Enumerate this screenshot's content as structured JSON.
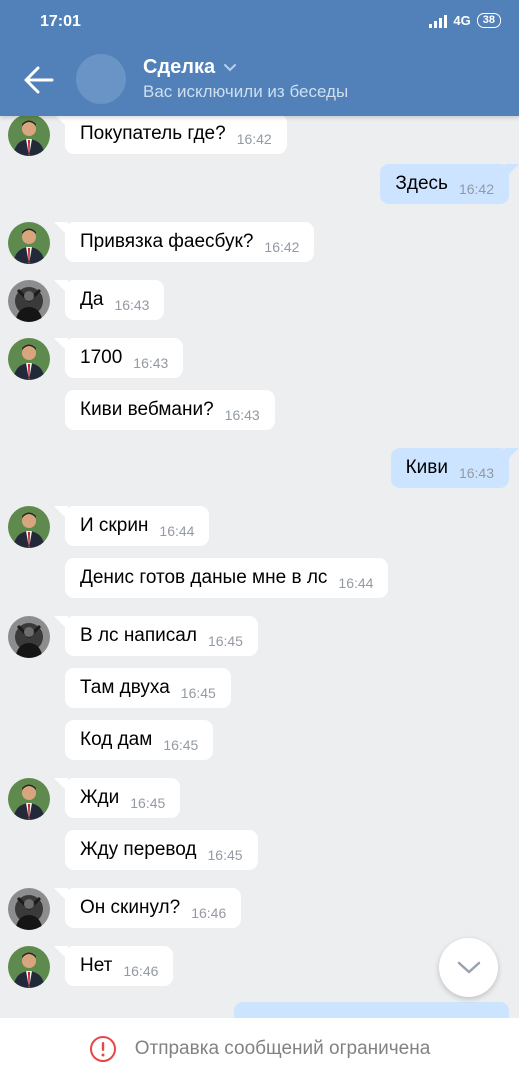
{
  "status_bar": {
    "time": "17:01",
    "network": "4G",
    "battery": "38"
  },
  "header": {
    "title": "Сделка",
    "subtitle": "Вас исключили из беседы"
  },
  "messages": [
    {
      "dir": "in",
      "avatar": "red",
      "text": "Покупатель где?",
      "time": "16:42"
    },
    {
      "dir": "out",
      "text": "Здесь",
      "time": "16:42"
    },
    {
      "dir": "in",
      "avatar": "red",
      "text": "Привязка фаесбук?",
      "time": "16:42"
    },
    {
      "dir": "in",
      "avatar": "dark",
      "text": "Да",
      "time": "16:43"
    },
    {
      "dir": "in",
      "avatar": "red",
      "text": "1700",
      "time": "16:43"
    },
    {
      "dir": "in",
      "text": "Киви вебмани?",
      "time": "16:43"
    },
    {
      "dir": "out",
      "text": "Киви",
      "time": "16:43"
    },
    {
      "dir": "in",
      "avatar": "red",
      "text": "И скрин",
      "time": "16:44"
    },
    {
      "dir": "in",
      "text": "Денис готов даные мне в лс",
      "time": "16:44"
    },
    {
      "dir": "in",
      "avatar": "dark",
      "text": "В лс написал",
      "time": "16:45"
    },
    {
      "dir": "in",
      "text": "Там двуха",
      "time": "16:45"
    },
    {
      "dir": "in",
      "text": "Код дам",
      "time": "16:45"
    },
    {
      "dir": "in",
      "avatar": "red",
      "text": "Жди",
      "time": "16:45"
    },
    {
      "dir": "in",
      "text": "Жду перевод",
      "time": "16:45"
    },
    {
      "dir": "in",
      "avatar": "dark",
      "text": "Он скинул?",
      "time": "16:46"
    },
    {
      "dir": "in",
      "avatar": "red",
      "text": "Нет",
      "time": "16:46"
    }
  ],
  "footer": {
    "restriction_text": "Отправка сообщений ограничена"
  },
  "icons": {
    "back": "back-arrow-icon",
    "title_dropdown": "chevron-down-icon",
    "scroll_down": "chevron-down-icon",
    "warning": "warning-circle-icon"
  },
  "colors": {
    "header": "#5181b8",
    "background": "#edeef0",
    "incoming_bubble": "#ffffff",
    "outgoing_bubble": "#cce4ff",
    "warning": "#e64646"
  }
}
